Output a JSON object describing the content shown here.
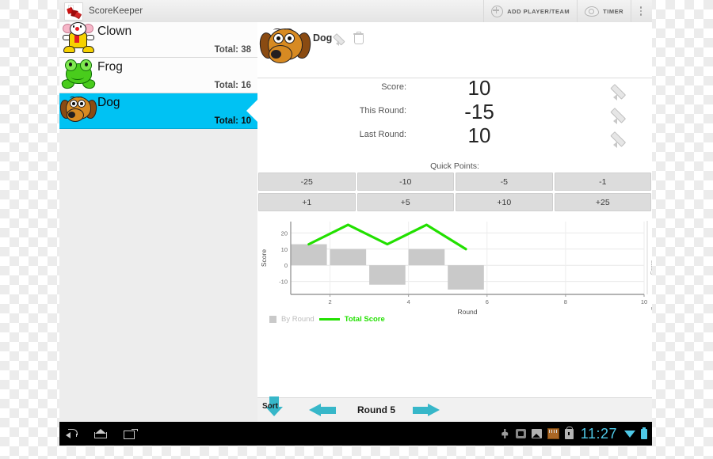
{
  "window": {
    "title": "ScoreKeeper",
    "logo_icon": "dice-cards-icon"
  },
  "actionbar": {
    "add_player_label": "ADD PLAYER/TEAM",
    "add_player_icon": "add-circle-icon",
    "timer_label": "TIMER",
    "timer_icon": "timer-eye-icon",
    "overflow_icon": "overflow-menu-icon"
  },
  "sidebar": {
    "players": [
      {
        "name": "Clown",
        "total_label": "Total: 38",
        "avatar_icon": "clown-avatar-icon",
        "selected": false
      },
      {
        "name": "Frog",
        "total_label": "Total: 16",
        "avatar_icon": "frog-avatar-icon",
        "selected": false
      },
      {
        "name": "Dog",
        "total_label": "Total: 10",
        "avatar_icon": "dog-avatar-icon",
        "selected": true
      }
    ]
  },
  "detail": {
    "player_name": "Dog",
    "avatar_icon": "dog-avatar-icon",
    "edit_name_icon": "pencil-icon",
    "delete_player_icon": "trash-icon",
    "rows": [
      {
        "label": "Score:",
        "value": "10",
        "edit_icon": "pencil-icon"
      },
      {
        "label": "This Round:",
        "value": "-15",
        "edit_icon": "pencil-icon"
      },
      {
        "label": "Last Round:",
        "value": "10",
        "edit_icon": "pencil-icon"
      }
    ],
    "quick_points_title": "Quick Points:",
    "quick_points": [
      "-25",
      "-10",
      "-5",
      "-1",
      "+1",
      "+5",
      "+10",
      "+25"
    ]
  },
  "chart_data": {
    "type": "bar",
    "title": "",
    "xlabel": "Round",
    "ylabel": "Score",
    "x": [
      1,
      2,
      3,
      4,
      5
    ],
    "xticks": [
      "2",
      "4",
      "6",
      "8",
      "10"
    ],
    "xtick_values": [
      2,
      4,
      6,
      8,
      10
    ],
    "xlim": [
      1,
      10
    ],
    "yticks": [
      "20",
      "10",
      "0",
      "-10"
    ],
    "ytick_values": [
      20,
      10,
      0,
      -10
    ],
    "ylim": [
      -18,
      27
    ],
    "grid": true,
    "legend": [
      "By Round",
      "Total Score"
    ],
    "legend_position": "bottom-left",
    "series": [
      {
        "name": "By Round",
        "type": "bar",
        "color": "#c9c9c9",
        "values": [
          13,
          10,
          -12,
          10,
          -15
        ]
      },
      {
        "name": "Total Score",
        "type": "line",
        "color": "#22e000",
        "values": [
          13,
          25,
          13,
          25,
          10
        ]
      }
    ]
  },
  "footer": {
    "sort_label": "Sort",
    "sort_icon": "arrow-down-icon",
    "prev_icon": "arrow-left-icon",
    "next_icon": "arrow-right-icon",
    "round_label": "Round 5"
  },
  "systembar": {
    "back_icon": "back-icon",
    "home_icon": "home-icon",
    "recents_icon": "recents-icon",
    "status_icons": [
      "usb-icon",
      "sd-card-icon",
      "screenshot-icon",
      "keyboard-icon",
      "lock-icon"
    ],
    "clock": "11:27",
    "wifi_icon": "wifi-icon",
    "battery_icon": "battery-icon",
    "accent_color": "#4ec9e8"
  },
  "colors": {
    "selection": "#00c2f3",
    "arrow": "#37b7c9",
    "line_series": "#22e000",
    "bar_series": "#c9c9c9"
  }
}
